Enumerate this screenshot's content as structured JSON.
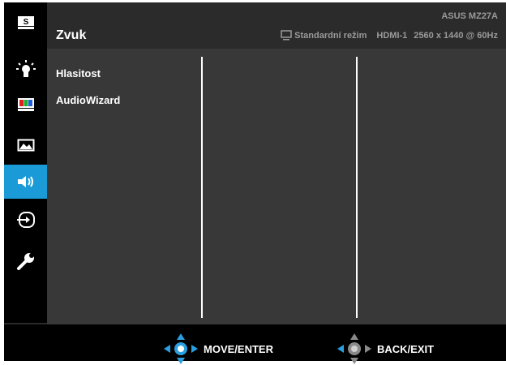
{
  "header": {
    "title": "Zvuk",
    "model": "ASUS MZ27A",
    "mode": "Standardní režim",
    "input": "HDMI-1",
    "resolution": "2560 x 1440 @ 60Hz"
  },
  "sidebar": {
    "items": [
      {
        "icon": "splendid-icon"
      },
      {
        "icon": "blue-light-filter-icon"
      },
      {
        "icon": "color-icon"
      },
      {
        "icon": "image-icon"
      },
      {
        "icon": "sound-icon",
        "active": true
      },
      {
        "icon": "input-select-icon"
      },
      {
        "icon": "system-setup-icon"
      }
    ]
  },
  "menu": {
    "items": [
      "Hlasitost",
      "AudioWizard"
    ]
  },
  "footer": {
    "move_label": "MOVE/ENTER",
    "back_label": "BACK/EXIT"
  },
  "colors": {
    "accent": "#1a9ad7",
    "background": "#383838",
    "sidebar": "#000000"
  }
}
